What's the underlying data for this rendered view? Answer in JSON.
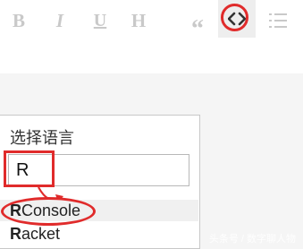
{
  "toolbar": {
    "bold_label": "B",
    "italic_label": "I",
    "underline_label": "U",
    "heading_label": "H",
    "quote_label": "“",
    "code_icon": "code-brackets-icon",
    "list_icon": "ordered-list-icon"
  },
  "language_panel": {
    "title": "选择语言",
    "input_value": "R",
    "options": [
      {
        "match": "R",
        "rest": "Console"
      },
      {
        "match": "R",
        "rest": "acket"
      }
    ]
  },
  "watermark": "头条号 / 数字聊人物",
  "colors": {
    "annotation": "#e02b2b",
    "toolbar_icon": "#c9c9c9",
    "editor_background": "#f5f5f5",
    "highlight_option": "#f0f0f0"
  }
}
